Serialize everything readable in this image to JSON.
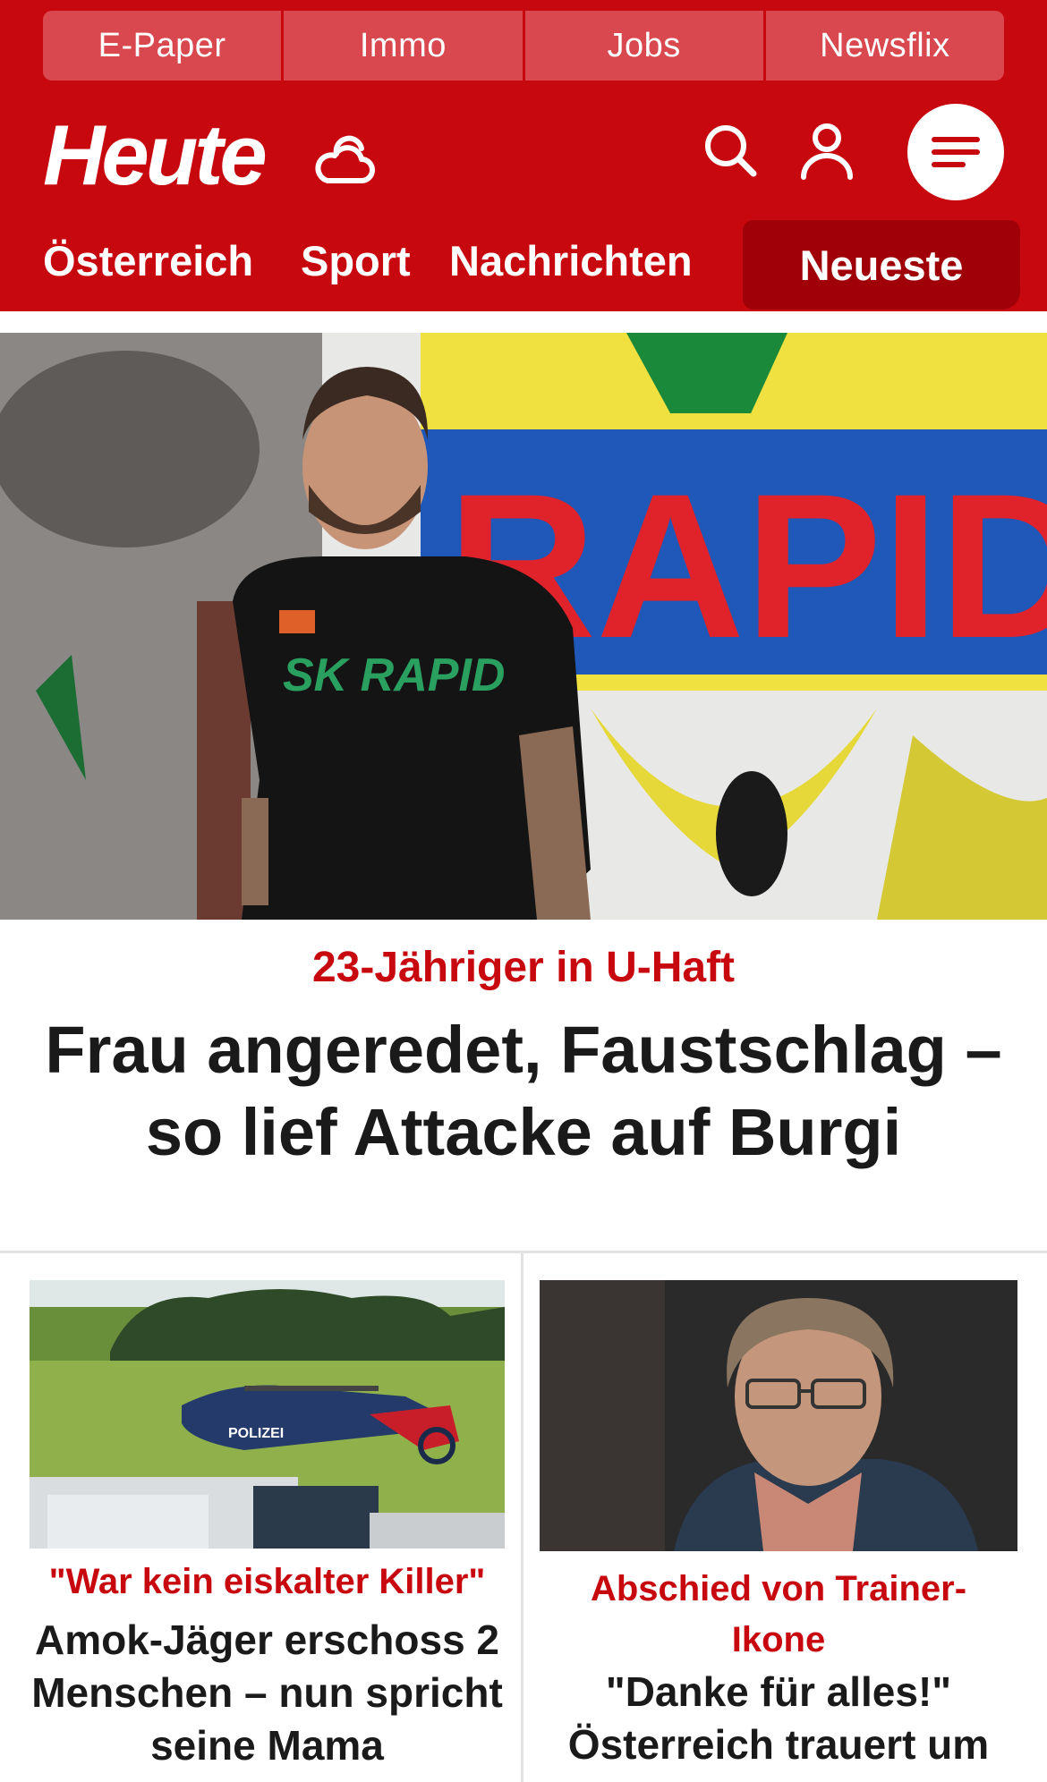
{
  "top_links": [
    "E-Paper",
    "Immo",
    "Jobs",
    "Newsflix"
  ],
  "brand": {
    "logo_text": "Heute",
    "accent_color": "#c8080f",
    "dark_accent": "#a00008"
  },
  "header_icons": [
    "weather-icon",
    "search-icon",
    "user-icon",
    "menu-icon"
  ],
  "nav": {
    "items": [
      "Österreich",
      "Sport",
      "Nachrichten"
    ],
    "active": "Neueste"
  },
  "hero_article": {
    "kicker": "23-Jähriger in U-Haft",
    "headline": "Frau angeredet, Faustschlag – so lief Attacke auf Burgi",
    "image_text": "RAPID",
    "shirt_text": "SK RAPID"
  },
  "articles": [
    {
      "kicker": "\"War kein eiskalter Killer\"",
      "headline": "Amok-Jäger erschoss 2 Menschen – nun spricht seine Mama",
      "image_text": "POLIZEI"
    },
    {
      "kicker": "Abschied von Trainer-Ikone",
      "headline": "\"Danke für alles!\" Österreich trauert um"
    }
  ]
}
